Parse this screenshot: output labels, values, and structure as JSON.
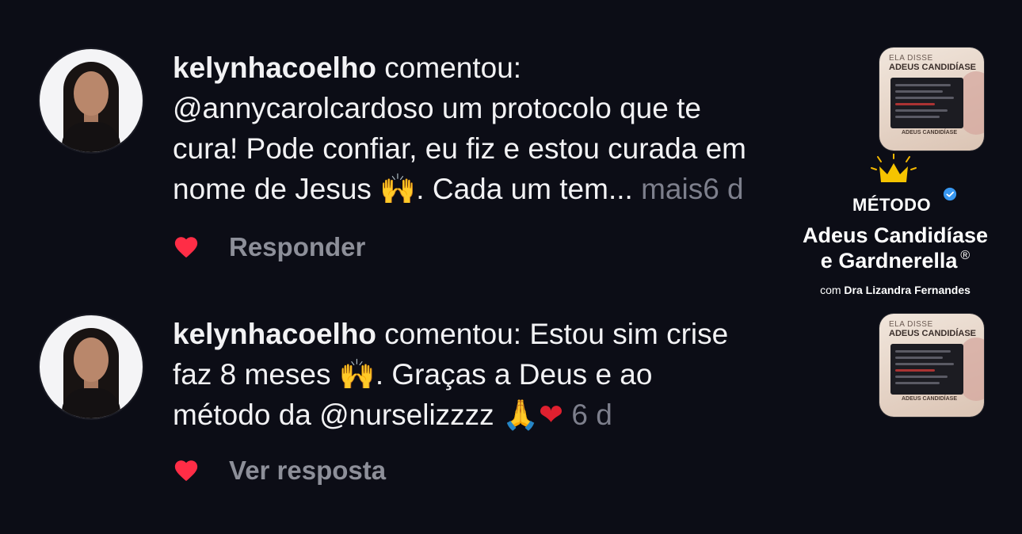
{
  "comments": [
    {
      "username": "kelynhacoelho",
      "verb": " comentou:",
      "text_line_1_rest": "",
      "lines": [
        "@annycarolcardoso  um protocolo que te",
        "cura! Pode confiar, eu fiz e estou curada em",
        "nome de Jesus "
      ],
      "emoji_1": "🙌",
      "after_emoji": ". Cada um tem... ",
      "more_label": "mais",
      "time": "6 d",
      "liked": true,
      "action_label": "Responder"
    },
    {
      "username": "kelynhacoelho",
      "verb": " comentou: Estou sim crise",
      "line_2_a": "faz 8 meses ",
      "emoji_2": "🙌",
      "line_2_b": ". Graças a Deus e ao",
      "line_3": "método da @nurselizzzz ",
      "emoji_3": "🙏",
      "emoji_4": "❤",
      "time": "6 d",
      "liked": true,
      "action_label": "Ver resposta"
    }
  ],
  "thumbnail": {
    "top_label": "ELA DISSE",
    "title": "ADEUS CANDIDÍASE",
    "footer": "ADEUS CANDIDÍASE"
  },
  "brand_overlay": {
    "metodo": "MÉTODO",
    "title_line_1": "Adeus Candidíase",
    "title_line_2": "e Gardnerella",
    "registered": "®",
    "byline_prefix": "com ",
    "byline_name": "Dra Lizandra Fernandes"
  },
  "colors": {
    "background": "#0c0d16",
    "text": "#f2f2f4",
    "muted": "#7d7f8c",
    "heart": "#ff2d46",
    "accent_crown": "#f5b800",
    "verified": "#3897f0"
  }
}
